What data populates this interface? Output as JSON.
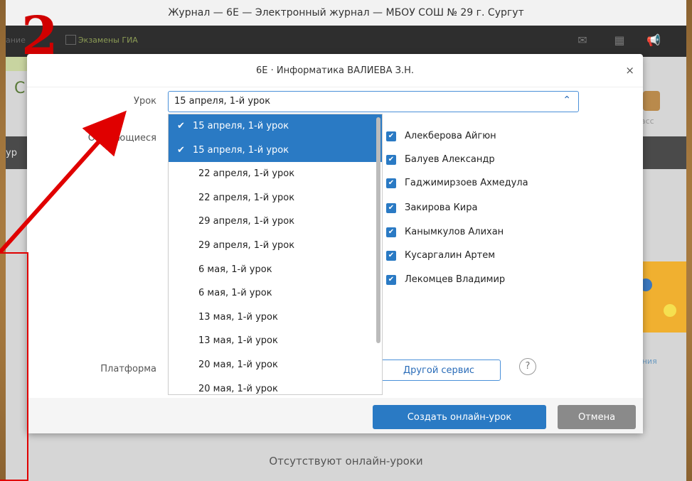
{
  "window": {
    "title": "Журнал — 6Е — Электронный журнал — МБОУ СОШ № 29 г. Сургут"
  },
  "nav": {
    "tab_left": "ание",
    "tab_exams": "Экзамены ГИА",
    "icons": [
      "mail-icon",
      "calendar-icon",
      "megaphone-icon"
    ]
  },
  "background": {
    "klass": "Класс",
    "absent_text": "Отсутствуют онлайн-уроки",
    "promo_text": "ания"
  },
  "annotation": {
    "number": "2",
    "color": "#d00000"
  },
  "modal": {
    "title": "6Е · Информатика ВАЛИЕВА З.Н.",
    "close": "×",
    "lesson_label": "Урок",
    "lesson_value": "15 апреля, 1-й урок",
    "students_label": "Обучающиеся",
    "platform_label": "Платформа",
    "options": [
      {
        "label": "15 апреля, 1-й урок",
        "selected": true
      },
      {
        "label": "15 апреля, 1-й урок",
        "selected": true
      },
      {
        "label": "22 апреля, 1-й урок",
        "selected": false
      },
      {
        "label": "22 апреля, 1-й урок",
        "selected": false
      },
      {
        "label": "29 апреля, 1-й урок",
        "selected": false
      },
      {
        "label": "29 апреля, 1-й урок",
        "selected": false
      },
      {
        "label": "6 мая, 1-й урок",
        "selected": false
      },
      {
        "label": "6 мая, 1-й урок",
        "selected": false
      },
      {
        "label": "13 мая, 1-й урок",
        "selected": false
      },
      {
        "label": "13 мая, 1-й урок",
        "selected": false
      },
      {
        "label": "20 мая, 1-й урок",
        "selected": false
      },
      {
        "label": "20 мая, 1-й урок",
        "selected": false
      }
    ],
    "students": [
      "Алекберова Айгюн",
      "Балуев Александр",
      "Гаджимирзоев Ахмедула",
      "Закирова Кира",
      "Канымкулов Алихан",
      "Кусаргалин Артем",
      "Лекомцев Владимир"
    ],
    "other_service": "Другой сервис",
    "help": "?",
    "create_button": "Создать онлайн-урок",
    "cancel_button": "Отмена"
  },
  "colors": {
    "accent": "#2a7ac4",
    "annotation_red": "#e00000"
  }
}
